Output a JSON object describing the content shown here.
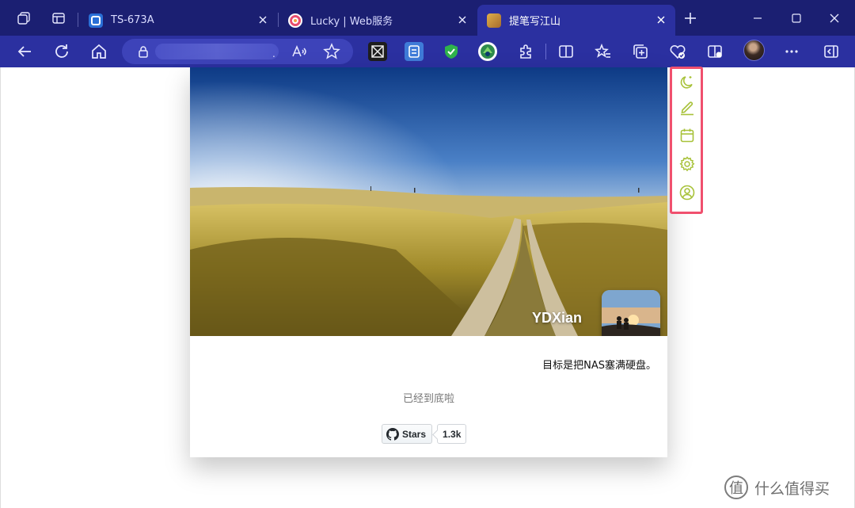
{
  "tabs": [
    {
      "title": "TS-673A",
      "active": false
    },
    {
      "title": "Lucky | Web服务",
      "active": false
    },
    {
      "title": "提笔写江山",
      "active": true
    }
  ],
  "address": {
    "visible_suffix": "."
  },
  "toolbar_icons": [
    "back-icon",
    "refresh-icon",
    "home-icon",
    "lock-icon",
    "read-aloud-icon",
    "favorite-star-icon",
    "extensions-icon",
    "split-screen-icon",
    "favorites-icon",
    "collections-icon",
    "browser-essentials-icon",
    "workspaces-icon",
    "more-icon",
    "sidebar-icon"
  ],
  "profile": {
    "name": "YDXian",
    "motto": "目标是把NAS塞满硬盘。"
  },
  "footer": {
    "end_text": "已经到底啦"
  },
  "github": {
    "stars_label": "Stars",
    "stars_count": "1.3k"
  },
  "floating_panel": {
    "icons": [
      "moon-icon",
      "pencil-icon",
      "calendar-icon",
      "gear-icon",
      "user-icon"
    ],
    "accent_color": "#a8c23a",
    "border_color": "#f0506e"
  },
  "watermark": {
    "logo_glyph": "值",
    "text": "什么值得买"
  },
  "colors": {
    "tabbar": "#1b1f72",
    "toolbar": "#2b30a0"
  }
}
